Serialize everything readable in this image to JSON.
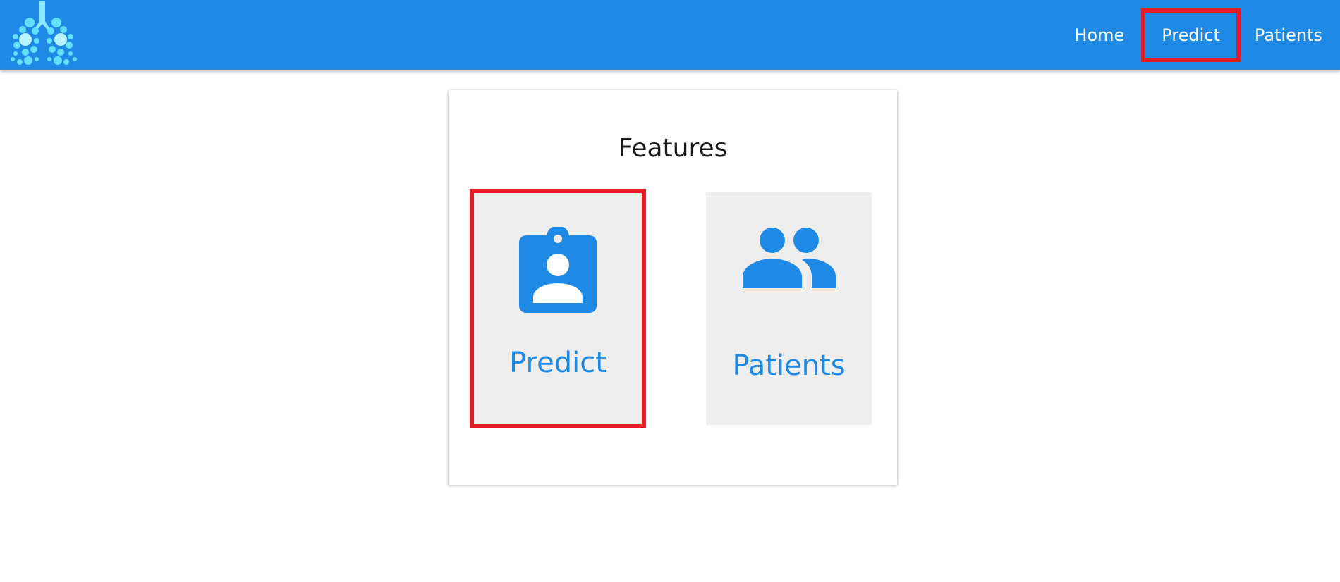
{
  "nav": {
    "logo_icon": "lungs-logo-icon",
    "links": [
      {
        "label": "Home"
      },
      {
        "label": "Predict"
      },
      {
        "label": "Patients"
      }
    ]
  },
  "features": {
    "title": "Features",
    "tiles": [
      {
        "label": "Predict",
        "icon": "badge-icon"
      },
      {
        "label": "Patients",
        "icon": "people-icon"
      }
    ]
  },
  "colors": {
    "primary": "#1f8ae6",
    "highlight": "#e31b23",
    "tile_bg": "#eeeeee"
  }
}
